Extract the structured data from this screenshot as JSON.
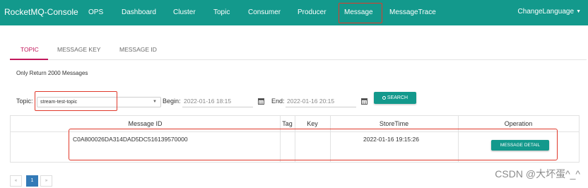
{
  "navbar": {
    "brand": "RocketMQ-Console",
    "items": [
      "OPS",
      "Dashboard",
      "Cluster",
      "Topic",
      "Consumer",
      "Producer",
      "Message",
      "MessageTrace"
    ],
    "active": "Message",
    "language": "ChangeLanguage",
    "bg_color": "#13998c"
  },
  "tabs": [
    {
      "label": "TOPIC",
      "active": true
    },
    {
      "label": "MESSAGE KEY",
      "active": false
    },
    {
      "label": "MESSAGE ID",
      "active": false
    }
  ],
  "info_text": "Only Return 2000 Messages",
  "search": {
    "topic_label": "Topic:",
    "topic_value": "stream-test-topic",
    "begin_label": "Begin:",
    "begin_value": "2022-01-16 18:15",
    "end_label": "End:",
    "end_value": "2022-01-16 20:15",
    "button_label": "SEARCH"
  },
  "table": {
    "headers": [
      "Message ID",
      "Tag",
      "Key",
      "StoreTime",
      "Operation"
    ],
    "rows": [
      {
        "message_id": "C0A800026DA314DAD5DC516139570000",
        "tag": "",
        "key": "",
        "store_time": "2022-01-16 19:15:26",
        "operation": "MESSAGE DETAIL"
      }
    ]
  },
  "pagination": {
    "prev": "«",
    "current": "1",
    "next": "»"
  },
  "watermark": "CSDN @大坏蛋^_^",
  "highlight_color": "#e0392b"
}
